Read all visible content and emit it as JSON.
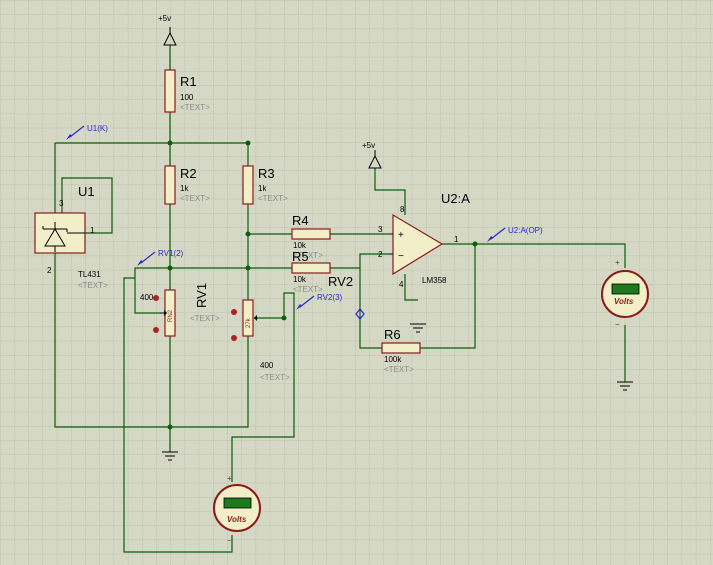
{
  "colors": {
    "background": "#d6d8c6",
    "grid": "#bfc2ac",
    "wire": "#0a5f0a",
    "component": "#8b1a1a",
    "fill": "#f2efc8",
    "label": "#000000",
    "placeholder": "#8a8a8a",
    "probe": "#2a2acd",
    "meter_display": "#1c7a1c"
  },
  "power": {
    "vcc_main": "+5v",
    "vcc_opamp": "+5v"
  },
  "r1": {
    "ref": "R1",
    "value": "100",
    "text": "<TEXT>"
  },
  "r2": {
    "ref": "R2",
    "value": "1k",
    "text": "<TEXT>"
  },
  "r3": {
    "ref": "R3",
    "value": "1k",
    "text": "<TEXT>"
  },
  "r4": {
    "ref": "R4",
    "value": "10k",
    "text": "<TEXT>"
  },
  "r5": {
    "ref": "R5",
    "value": "10k",
    "text": "<TEXT>"
  },
  "r6": {
    "ref": "R6",
    "value": "100k",
    "text": "<TEXT>"
  },
  "u1": {
    "ref": "U1",
    "part": "TL431",
    "text": "<TEXT>",
    "pin1": "1",
    "pin2": "2",
    "pin3": "3"
  },
  "rv1": {
    "ref": "RV1",
    "value": "400",
    "text": "<TEXT>",
    "body": "RN2"
  },
  "rv2": {
    "ref": "RV2",
    "value": "400",
    "text": "<TEXT>",
    "body": "27k"
  },
  "u2": {
    "ref": "U2:A",
    "part": "LM358",
    "pin1": "1",
    "pin2": "2",
    "pin3": "3",
    "pin4": "4",
    "pin8": "8",
    "plus": "+",
    "minus": "−"
  },
  "probes": {
    "u1k": "U1(K)",
    "rv1": "RV1(2)",
    "rv2": "RV2(3)",
    "u2a": "U2:A(OP)"
  },
  "voltmeter": {
    "unit": "Volts",
    "plus": "+",
    "minus": "−"
  }
}
